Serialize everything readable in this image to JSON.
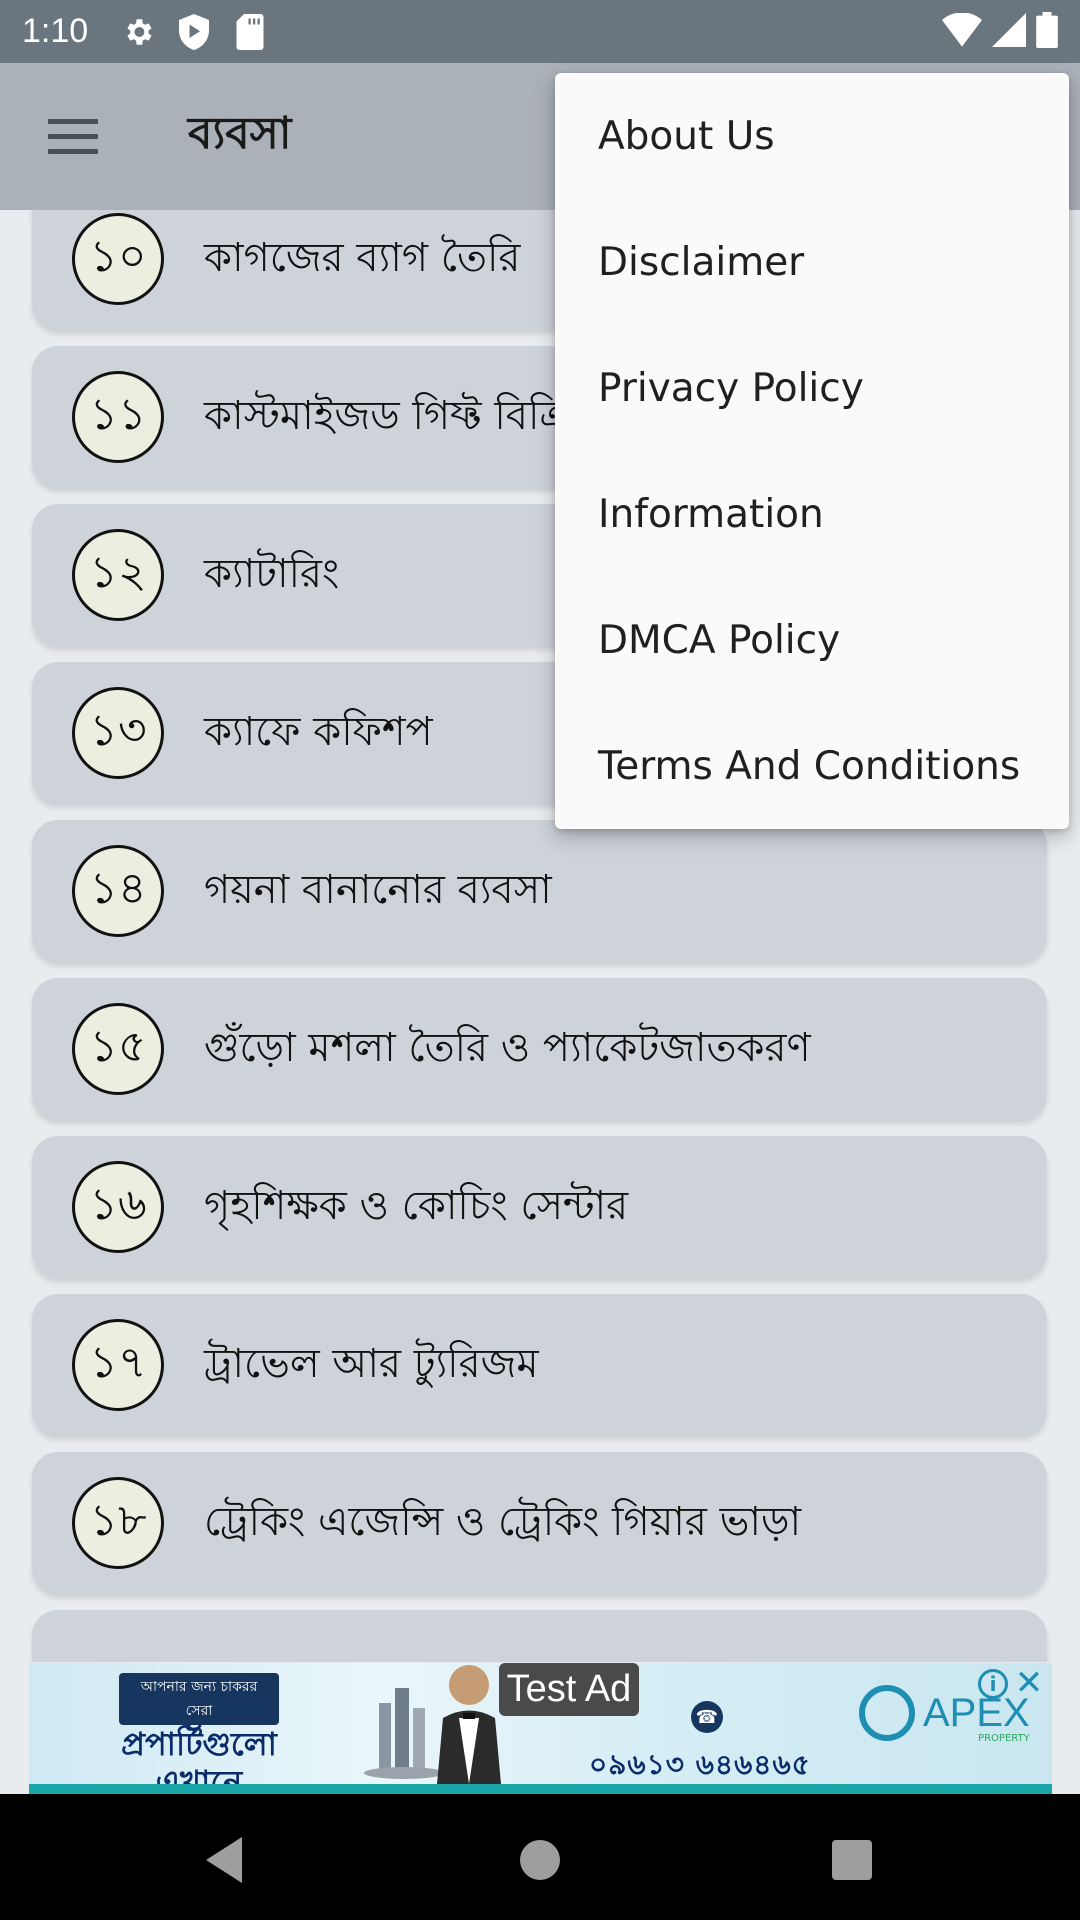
{
  "status_bar": {
    "time": "1:10",
    "left_icons": [
      "gear-icon",
      "shield-play-icon",
      "sd-card-icon"
    ],
    "right_icons": [
      "wifi-icon",
      "cellular-signal-icon",
      "battery-icon"
    ]
  },
  "app_bar": {
    "menu_icon": "hamburger-menu-icon",
    "title": "ব্যবসা"
  },
  "list": {
    "items": [
      {
        "number": "১০",
        "title": "কাগজের ব্যাগ তৈরি"
      },
      {
        "number": "১১",
        "title": "কাস্টমাইজড গিফ্ট বিক্রি"
      },
      {
        "number": "১২",
        "title": "ক্যাটারিং"
      },
      {
        "number": "১৩",
        "title": "ক্যাফে কফিশপ"
      },
      {
        "number": "১৪",
        "title": "গয়না বানানোর ব্যবসা"
      },
      {
        "number": "১৫",
        "title": "গুঁড়ো মশলা তৈরি ও প্যাকেটজাতকরণ"
      },
      {
        "number": "১৬",
        "title": "গৃহশিক্ষক ও কোচিং সেন্টার"
      },
      {
        "number": "১৭",
        "title": "ট্রাভেল আর ট্যুরিজম"
      },
      {
        "number": "১৮",
        "title": "ট্রেকিং এজেন্সি ও ট্রেকিং গিয়ার ভাড়া"
      }
    ]
  },
  "overflow_menu": {
    "items": [
      {
        "label": "About Us"
      },
      {
        "label": "Disclaimer"
      },
      {
        "label": "Privacy Policy"
      },
      {
        "label": "Information"
      },
      {
        "label": "DMCA Policy"
      },
      {
        "label": "Terms And Conditions"
      }
    ]
  },
  "ad": {
    "test_label": "Test Ad",
    "tagline": "আপনার জন্য চাকরর সেরা",
    "headline_1": "প্রপার্টিগুলো",
    "headline_2": "এখানে",
    "phone": "০৯৬১৩ ৬৪৬৪৬৫",
    "brand": "APEX",
    "brand_sub": "PROPERTY",
    "info_icon": "info-icon",
    "close_icon": "close-icon",
    "close_symbol": "✕",
    "info_symbol": "i"
  },
  "nav_bar": {
    "buttons": [
      "back-icon",
      "home-icon",
      "recents-icon"
    ]
  },
  "colors": {
    "status_bar": "#6b757d",
    "app_bar": "#aab1b8",
    "card": "#ced3da",
    "badge_fill": "#eceedf",
    "menu_bg": "#fafafa",
    "ad_stripe": "#1aa6a6"
  }
}
